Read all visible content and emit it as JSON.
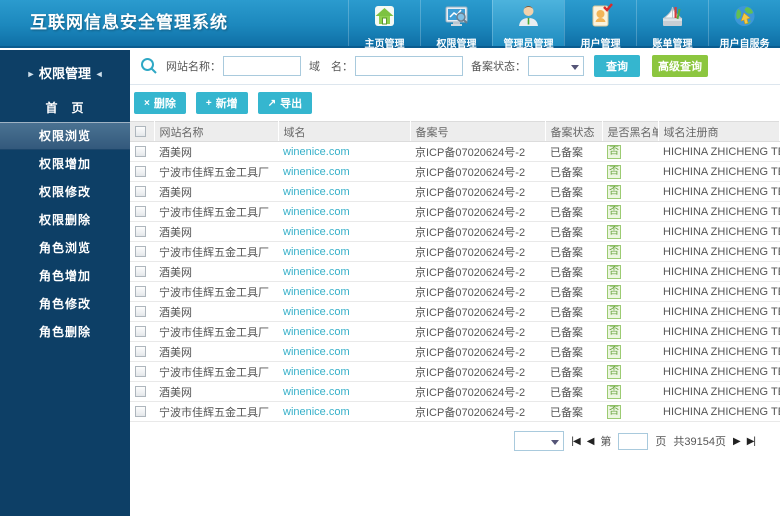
{
  "app": {
    "title": "互联网信息安全管理系统"
  },
  "topnav": {
    "items": [
      {
        "label": "主页管理",
        "icon": "home-icon"
      },
      {
        "label": "权限管理",
        "icon": "monitor-search-icon"
      },
      {
        "label": "管理员管理",
        "icon": "admin-person-icon"
      },
      {
        "label": "用户管理",
        "icon": "user-card-icon"
      },
      {
        "label": "账单管理",
        "icon": "ledger-book-icon"
      },
      {
        "label": "用户自服务",
        "icon": "globe-icon"
      }
    ],
    "active_index": 2
  },
  "sidebar": {
    "arrow_prefix": "►",
    "title": "权限管理",
    "arrow_suffix": "◄",
    "items": [
      {
        "label": "首　页"
      },
      {
        "label": "权限浏览"
      },
      {
        "label": "权限增加"
      },
      {
        "label": "权限修改"
      },
      {
        "label": "权限删除"
      },
      {
        "label": "角色浏览"
      },
      {
        "label": "角色增加"
      },
      {
        "label": "角色修改"
      },
      {
        "label": "角色删除"
      }
    ],
    "active_index": 1
  },
  "search": {
    "site_label": "网站名称：",
    "site_value": "",
    "domain_label": "域　名：",
    "domain_value": "",
    "status_label": "备案状态：",
    "status_value": "",
    "query_button": "查询",
    "advanced_button": "高级查询"
  },
  "toolbar": {
    "delete_icon": "×",
    "delete_label": "删除",
    "add_icon": "+",
    "add_label": "新增",
    "export_icon": "↗",
    "export_label": "导出"
  },
  "table": {
    "headers": [
      "网站名称",
      "域名",
      "备案号",
      "备案状态",
      "是否黑名单",
      "域名注册商"
    ],
    "rows": [
      {
        "site": "酒美网",
        "domain": "winenice.com",
        "icp": "京ICP备07020624号-2",
        "status": "已备案",
        "blacklist": "否",
        "registrar": "HICHINA ZHICHENG TECHNOLOGY"
      },
      {
        "site": "宁波市佳辉五金工具厂",
        "domain": "winenice.com",
        "icp": "京ICP备07020624号-2",
        "status": "已备案",
        "blacklist": "否",
        "registrar": "HICHINA ZHICHENG TECHNOLOGY"
      },
      {
        "site": "酒美网",
        "domain": "winenice.com",
        "icp": "京ICP备07020624号-2",
        "status": "已备案",
        "blacklist": "否",
        "registrar": "HICHINA ZHICHENG TECHNOLOGY"
      },
      {
        "site": "宁波市佳辉五金工具厂",
        "domain": "winenice.com",
        "icp": "京ICP备07020624号-2",
        "status": "已备案",
        "blacklist": "否",
        "registrar": "HICHINA ZHICHENG TECHNOLOGY"
      },
      {
        "site": "酒美网",
        "domain": "winenice.com",
        "icp": "京ICP备07020624号-2",
        "status": "已备案",
        "blacklist": "否",
        "registrar": "HICHINA ZHICHENG TECHNOLOGY"
      },
      {
        "site": "宁波市佳辉五金工具厂",
        "domain": "winenice.com",
        "icp": "京ICP备07020624号-2",
        "status": "已备案",
        "blacklist": "否",
        "registrar": "HICHINA ZHICHENG TECHNOLOGY"
      },
      {
        "site": "酒美网",
        "domain": "winenice.com",
        "icp": "京ICP备07020624号-2",
        "status": "已备案",
        "blacklist": "否",
        "registrar": "HICHINA ZHICHENG TECHNOLOGY"
      },
      {
        "site": "宁波市佳辉五金工具厂",
        "domain": "winenice.com",
        "icp": "京ICP备07020624号-2",
        "status": "已备案",
        "blacklist": "否",
        "registrar": "HICHINA ZHICHENG TECHNOLOGY"
      },
      {
        "site": "酒美网",
        "domain": "winenice.com",
        "icp": "京ICP备07020624号-2",
        "status": "已备案",
        "blacklist": "否",
        "registrar": "HICHINA ZHICHENG TECHNOLOGY"
      },
      {
        "site": "宁波市佳辉五金工具厂",
        "domain": "winenice.com",
        "icp": "京ICP备07020624号-2",
        "status": "已备案",
        "blacklist": "否",
        "registrar": "HICHINA ZHICHENG TECHNOLOGY"
      },
      {
        "site": "酒美网",
        "domain": "winenice.com",
        "icp": "京ICP备07020624号-2",
        "status": "已备案",
        "blacklist": "否",
        "registrar": "HICHINA ZHICHENG TECHNOLOGY"
      },
      {
        "site": "宁波市佳辉五金工具厂",
        "domain": "winenice.com",
        "icp": "京ICP备07020624号-2",
        "status": "已备案",
        "blacklist": "否",
        "registrar": "HICHINA ZHICHENG TECHNOLOGY"
      },
      {
        "site": "酒美网",
        "domain": "winenice.com",
        "icp": "京ICP备07020624号-2",
        "status": "已备案",
        "blacklist": "否",
        "registrar": "HICHINA ZHICHENG TECHNOLOGY"
      },
      {
        "site": "宁波市佳辉五金工具厂",
        "domain": "winenice.com",
        "icp": "京ICP备07020624号-2",
        "status": "已备案",
        "blacklist": "否",
        "registrar": "HICHINA ZHICHENG TECHNOLOGY"
      }
    ]
  },
  "pagination": {
    "first_icon": "◀",
    "prev_icon": "◀",
    "page_prefix": "第",
    "page_value": "",
    "page_suffix": "页",
    "total_text": "共39154页",
    "next_icon": "▶",
    "last_icon": "▶"
  },
  "colors": {
    "header_top": "#2b9bce",
    "header_bottom": "#0f6fa6",
    "sidebar": "#0d3f66",
    "accent_teal": "#35b6cf",
    "accent_green": "#8cc63f",
    "link_teal": "#36b0c9",
    "badge_green": "#67a23c",
    "table_header_bg": "#ededed"
  }
}
